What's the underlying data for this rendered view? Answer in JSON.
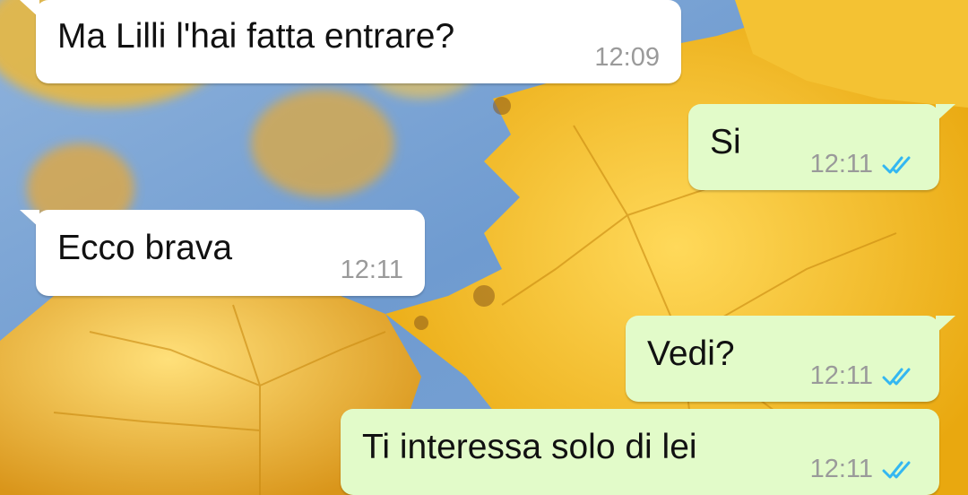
{
  "colors": {
    "incoming_bubble": "#ffffff",
    "outgoing_bubble": "#e2fbc9",
    "read_ticks": "#34b7f1",
    "timestamp": "#9a9a9a"
  },
  "messages": [
    {
      "direction": "incoming",
      "text": "Ma Lilli l'hai fatta entrare?",
      "time": "12:09"
    },
    {
      "direction": "outgoing",
      "text": "Si",
      "time": "12:11",
      "status_icon": "double-check-read-icon"
    },
    {
      "direction": "incoming",
      "text": "Ecco brava",
      "time": "12:11"
    },
    {
      "direction": "outgoing",
      "text": "Vedi?",
      "time": "12:11",
      "status_icon": "double-check-read-icon"
    },
    {
      "direction": "outgoing",
      "text": "Ti interessa solo di lei",
      "time": "12:11",
      "status_icon": "double-check-read-icon"
    }
  ]
}
